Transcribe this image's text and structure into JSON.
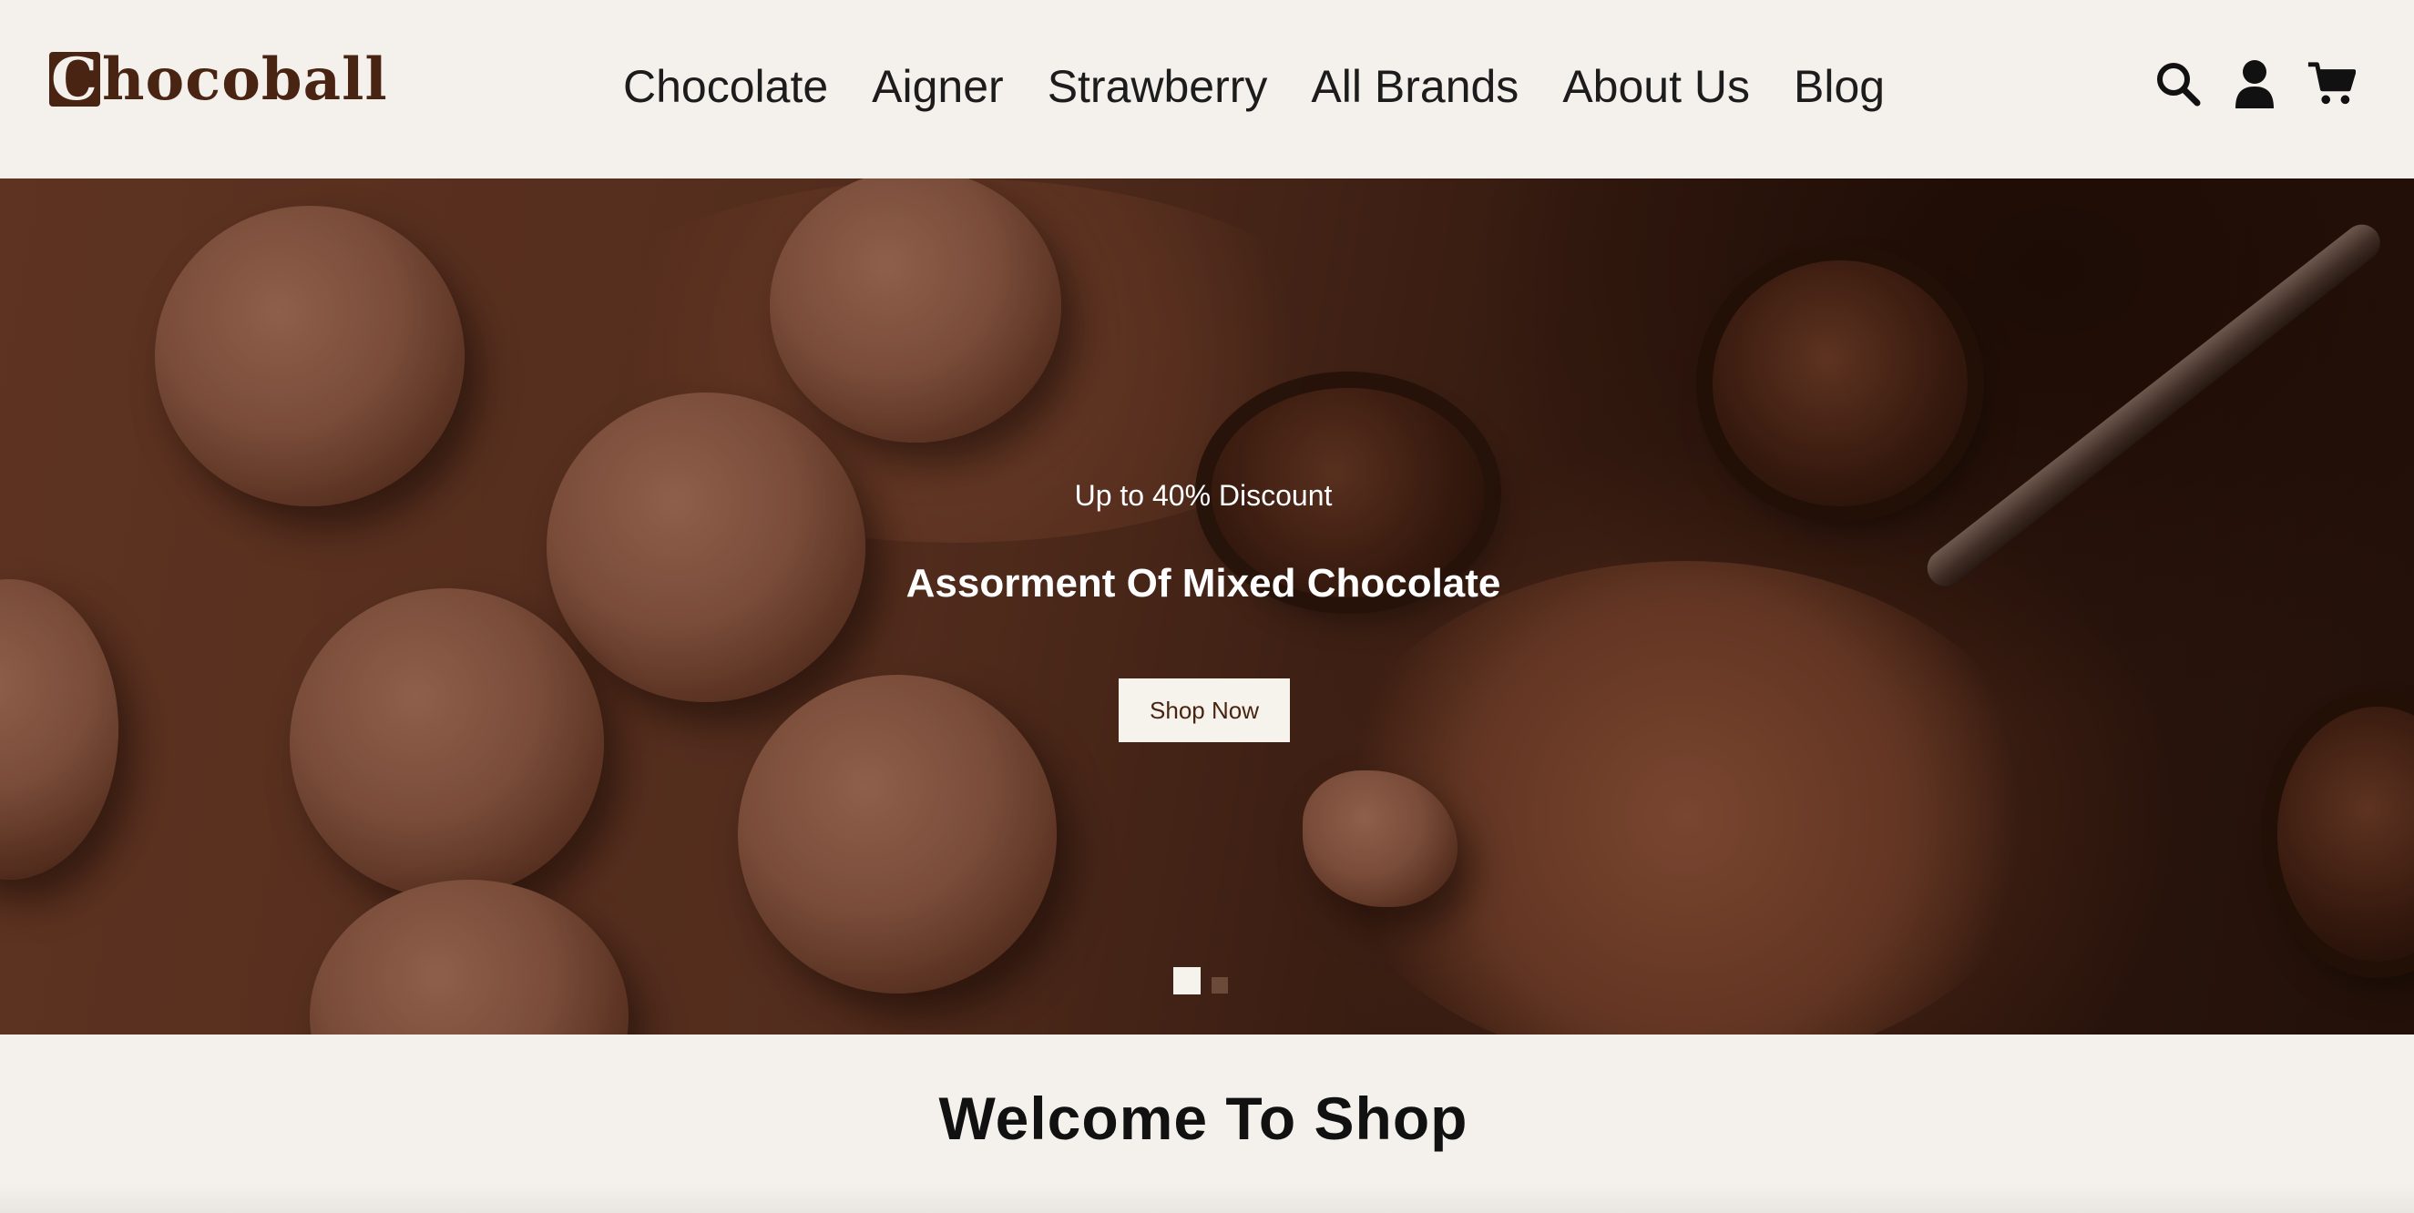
{
  "header": {
    "logo_initial": "C",
    "logo_rest": "hocoball",
    "nav": [
      "Chocolate",
      "Aigner",
      "Strawberry",
      "All Brands",
      "About Us",
      "Blog"
    ],
    "icons": [
      "search-icon",
      "user-icon",
      "cart-icon"
    ]
  },
  "hero": {
    "discount": "Up to 40% Discount",
    "headline": "Assorment Of Mixed Chocolate",
    "button": "Shop Now",
    "slides": 2,
    "active_slide": 1
  },
  "welcome": {
    "title": "Welcome To Shop"
  },
  "colors": {
    "background": "#f4f1ec",
    "brand": "#4a2412",
    "button_bg": "#f6f2ec",
    "text_dark": "#111111"
  }
}
